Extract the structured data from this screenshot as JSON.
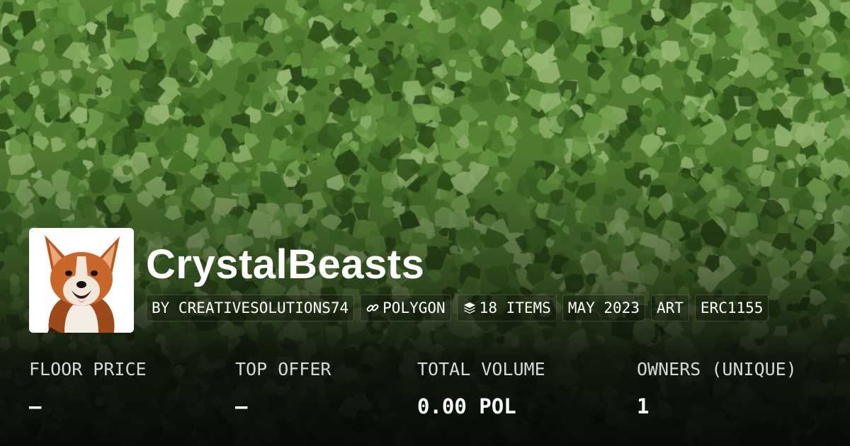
{
  "collection": {
    "name": "CrystalBeasts",
    "avatar_icon": "corgi-avatar-icon"
  },
  "tags": {
    "creator": "BY CREATIVESOLUTIONS74",
    "chain": "POLYGON",
    "chain_icon": "link-icon",
    "items": "18 ITEMS",
    "items_icon": "layers-icon",
    "date": "MAY 2023",
    "category": "ART",
    "standard": "ERC1155"
  },
  "stats": {
    "floor_price": {
      "label": "FLOOR PRICE",
      "value": "–"
    },
    "top_offer": {
      "label": "TOP OFFER",
      "value": "–"
    },
    "total_volume": {
      "label": "TOTAL VOLUME",
      "value": "0.00 POL"
    },
    "owners": {
      "label": "OWNERS (UNIQUE)",
      "value": "1"
    }
  },
  "theme": {
    "background": "#4f7a2e",
    "text": "#ffffff"
  }
}
